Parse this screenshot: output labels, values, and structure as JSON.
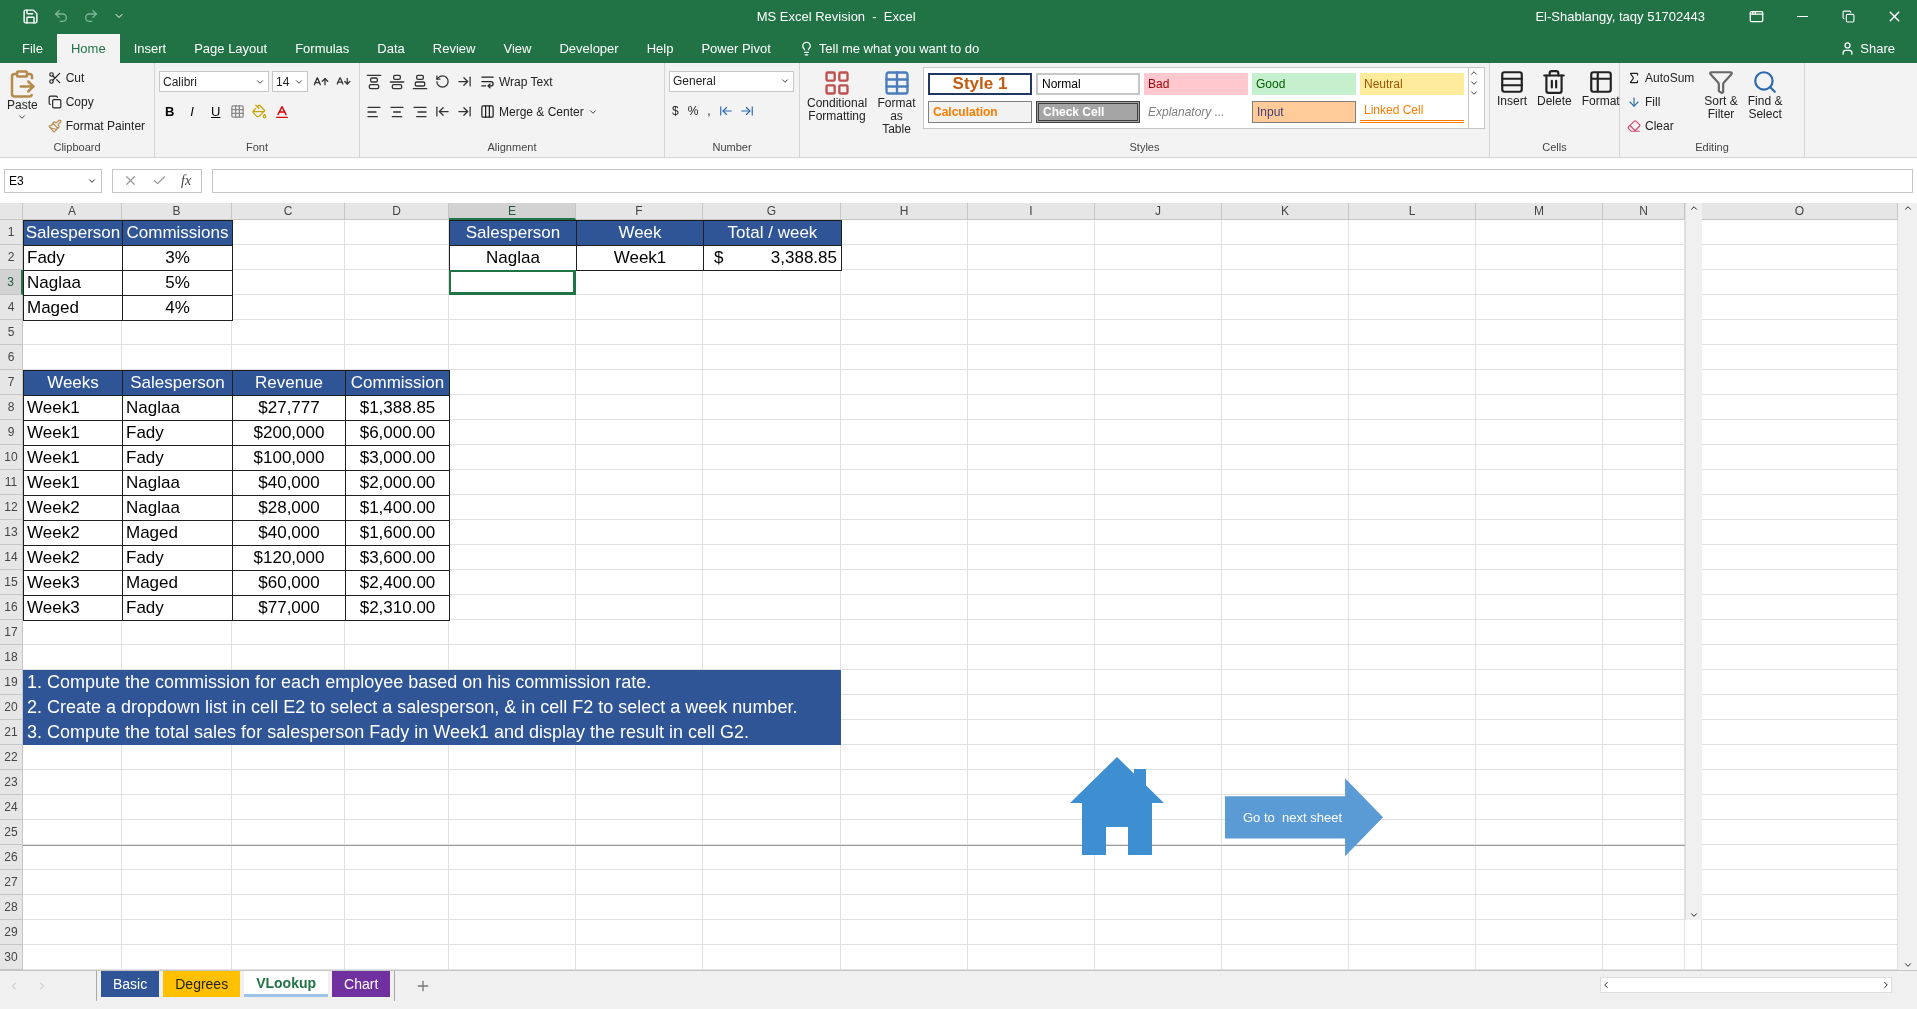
{
  "title_bar": {
    "title": "MS Excel Revision  -  Excel",
    "user": "El-Shablangy, taqy 51702443"
  },
  "menu_tabs": [
    {
      "label": "File",
      "selected": false
    },
    {
      "label": "Home",
      "selected": true
    },
    {
      "label": "Insert",
      "selected": false
    },
    {
      "label": "Page Layout",
      "selected": false
    },
    {
      "label": "Formulas",
      "selected": false
    },
    {
      "label": "Data",
      "selected": false
    },
    {
      "label": "Review",
      "selected": false
    },
    {
      "label": "View",
      "selected": false
    },
    {
      "label": "Developer",
      "selected": false
    },
    {
      "label": "Help",
      "selected": false
    },
    {
      "label": "Power Pivot",
      "selected": false
    }
  ],
  "tell_me": "Tell me what you want to do",
  "share": "Share",
  "clipboard": {
    "paste": "Paste",
    "cut": "Cut",
    "copy": "Copy",
    "format_painter": "Format Painter",
    "label": "Clipboard"
  },
  "font": {
    "name": "Calibri",
    "size": "14",
    "bold": "B",
    "italic": "I",
    "underline": "U",
    "label": "Font"
  },
  "alignment": {
    "wrap_text": "Wrap Text",
    "merge_center": "Merge & Center",
    "label": "Alignment"
  },
  "number": {
    "format": "General",
    "currency": "$",
    "percent": "%",
    "comma": ",",
    "label": "Number"
  },
  "styles": {
    "conditional": [
      "Conditional",
      "Formatting"
    ],
    "format_table": [
      "Format as",
      "Table"
    ],
    "label": "Styles",
    "gallery": [
      {
        "kind": "style1",
        "label": "Style 1"
      },
      {
        "kind": "normal",
        "label": "Normal"
      },
      {
        "kind": "bad",
        "label": "Bad"
      },
      {
        "kind": "good",
        "label": "Good"
      },
      {
        "kind": "neutral",
        "label": "Neutral"
      },
      {
        "kind": "calculation",
        "label": "Calculation"
      },
      {
        "kind": "check",
        "label": "Check Cell"
      },
      {
        "kind": "explanatory",
        "label": "Explanatory ..."
      },
      {
        "kind": "input",
        "label": "Input"
      },
      {
        "kind": "linked",
        "label": "Linked Cell"
      }
    ]
  },
  "cells": {
    "insert": "Insert",
    "delete": "Delete",
    "format": "Format",
    "label": "Cells"
  },
  "editing": {
    "autosum": "AutoSum",
    "fill": "Fill",
    "clear": "Clear",
    "sort": [
      "Sort &",
      "Filter"
    ],
    "find": [
      "Find &",
      "Select"
    ],
    "label": "Editing"
  },
  "formula_bar": {
    "name_box": "E3",
    "function": "fx"
  },
  "columns": [
    {
      "label": "A",
      "selected": false
    },
    {
      "label": "B",
      "selected": false
    },
    {
      "label": "C",
      "selected": false
    },
    {
      "label": "D",
      "selected": false
    },
    {
      "label": "E",
      "selected": true
    },
    {
      "label": "F",
      "selected": false
    },
    {
      "label": "G",
      "selected": false
    },
    {
      "label": "H",
      "selected": false
    },
    {
      "label": "I",
      "selected": false
    },
    {
      "label": "J",
      "selected": false
    },
    {
      "label": "K",
      "selected": false
    },
    {
      "label": "L",
      "selected": false
    },
    {
      "label": "M",
      "selected": false
    },
    {
      "label": "N",
      "selected": false
    },
    {
      "label": "O",
      "selected": false
    }
  ],
  "rows": [
    {
      "label": "1",
      "selected": false
    },
    {
      "label": "2",
      "selected": false
    },
    {
      "label": "3",
      "selected": true
    },
    {
      "label": "4",
      "selected": false
    },
    {
      "label": "5",
      "selected": false
    },
    {
      "label": "6",
      "selected": false
    },
    {
      "label": "7",
      "selected": false
    },
    {
      "label": "8",
      "selected": false
    },
    {
      "label": "9",
      "selected": false
    },
    {
      "label": "10",
      "selected": false
    },
    {
      "label": "11",
      "selected": false
    },
    {
      "label": "12",
      "selected": false
    },
    {
      "label": "13",
      "selected": false
    },
    {
      "label": "14",
      "selected": false
    },
    {
      "label": "15",
      "selected": false
    },
    {
      "label": "16",
      "selected": false
    },
    {
      "label": "17",
      "selected": false
    },
    {
      "label": "18",
      "selected": false
    },
    {
      "label": "19",
      "selected": false
    },
    {
      "label": "20",
      "selected": false
    },
    {
      "label": "21",
      "selected": false
    },
    {
      "label": "22",
      "selected": false
    },
    {
      "label": "23",
      "selected": false
    },
    {
      "label": "24",
      "selected": false
    },
    {
      "label": "25",
      "selected": false
    },
    {
      "label": "26",
      "selected": false
    },
    {
      "label": "27",
      "selected": false
    },
    {
      "label": "28",
      "selected": false
    },
    {
      "label": "29",
      "selected": false
    },
    {
      "label": "30",
      "selected": false
    }
  ],
  "commission_table": {
    "columns": [
      "Salesperson",
      "Commissions"
    ],
    "rows": [
      [
        "Fady",
        "3%"
      ],
      [
        "Naglaa",
        "5%"
      ],
      [
        "Maged",
        "4%"
      ]
    ]
  },
  "summary_table": {
    "columns": [
      "Salesperson",
      "Week",
      "Total / week"
    ],
    "row": {
      "salesperson": "Naglaa",
      "week": "Week1",
      "currency": "$",
      "total": "3,388.85"
    }
  },
  "sales_table": {
    "columns": [
      "Weeks",
      "Salesperson",
      "Revenue",
      "Commission"
    ],
    "rows": [
      [
        "Week1",
        "Naglaa",
        "$27,777",
        "$1,388.85"
      ],
      [
        "Week1",
        "Fady",
        "$200,000",
        "$6,000.00"
      ],
      [
        "Week1",
        "Fady",
        "$100,000",
        "$3,000.00"
      ],
      [
        "Week1",
        "Naglaa",
        "$40,000",
        "$2,000.00"
      ],
      [
        "Week2",
        "Naglaa",
        "$28,000",
        "$1,400.00"
      ],
      [
        "Week2",
        "Maged",
        "$40,000",
        "$1,600.00"
      ],
      [
        "Week2",
        "Fady",
        "$120,000",
        "$3,600.00"
      ],
      [
        "Week3",
        "Maged",
        "$60,000",
        "$2,400.00"
      ],
      [
        "Week3",
        "Fady",
        "$77,000",
        "$2,310.00"
      ]
    ]
  },
  "instructions": [
    "1. Compute the commission for each employee based on his commission rate.",
    "2. Create a dropdown list in cell E2 to select a salesperson, & in cell F2 to select a week number.",
    "3. Compute the total sales for salesperson Fady in Week1 and display the result in cell G2."
  ],
  "next_sheet_button": "Go to  next sheet",
  "sheet_tabs": [
    {
      "label": "Basic",
      "color": "#2f5597",
      "selected": false
    },
    {
      "label": "Degrees",
      "color": "#ffc000",
      "selected": false
    },
    {
      "label": "VLookup",
      "color": "#9dc3e6",
      "selected": true
    },
    {
      "label": "Chart",
      "color": "#7030a0",
      "selected": false
    }
  ]
}
